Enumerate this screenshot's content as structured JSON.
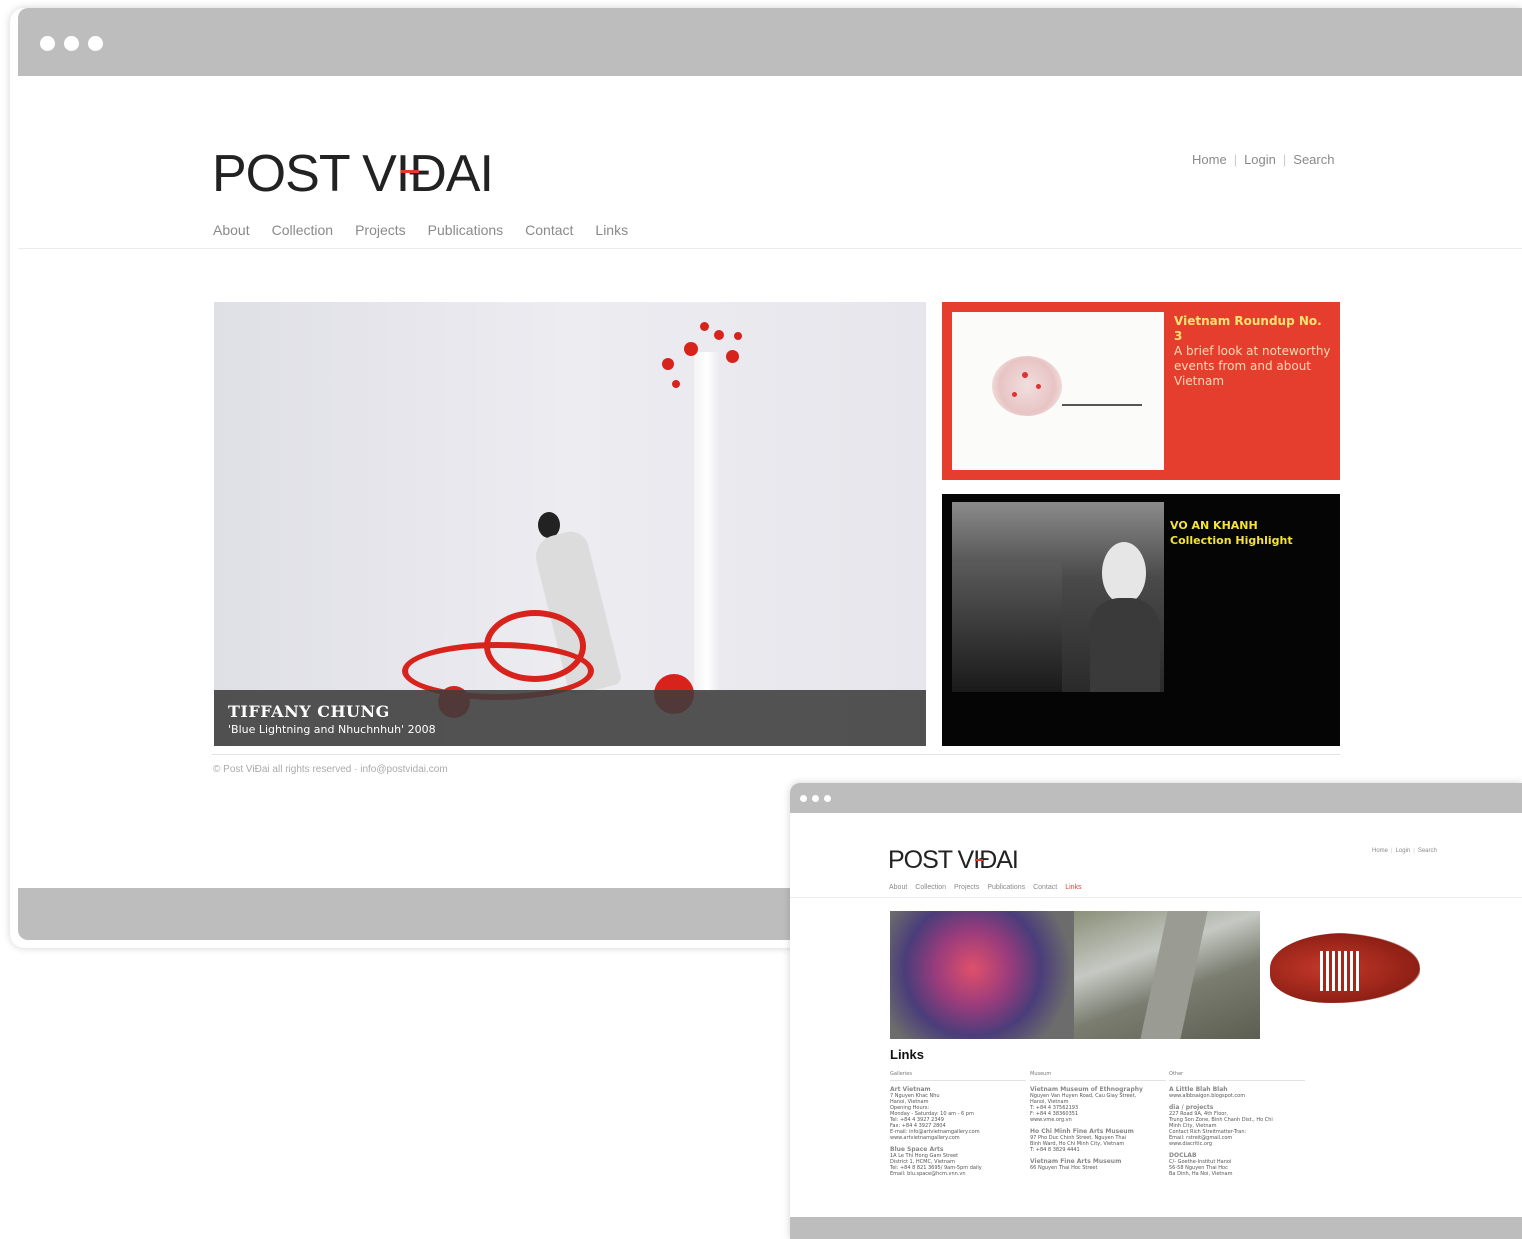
{
  "site": {
    "logo_prefix": "POST VI",
    "logo_d": "Đ",
    "logo_suffix": "AI",
    "topnav": [
      "Home",
      "Login",
      "Search"
    ],
    "nav": [
      "About",
      "Collection",
      "Projects",
      "Publications",
      "Contact",
      "Links"
    ],
    "colors": {
      "accent": "#e53e2e",
      "caption_yellow": "#f4e23a"
    }
  },
  "main_window": {
    "hero": {
      "artist": "TIFFANY CHUNG",
      "work": "'Blue Lightning and Nhuchnhuh' 2008"
    },
    "card_roundup": {
      "title": "Vietnam Roundup No. 3",
      "body": "A brief look at noteworthy events from and about Vietnam"
    },
    "card_highlight": {
      "title": "VO AN KHANH",
      "subtitle": "Collection Highlight"
    },
    "footer": "© Post ViĐai all rights reserved · info@postvidai.com"
  },
  "links_window": {
    "active_nav": "Links",
    "heading": "Links",
    "columns": [
      {
        "header": "Galleries",
        "entries": [
          {
            "name": "Art Vietnam",
            "lines": [
              "7 Nguyen Khac Nhu",
              "Hanoi, Vietnam",
              "Opening Hours:",
              "Monday - Saturday: 10 am - 6 pm",
              "Tel: +84 4 3927 2349",
              "Fax: +84 4 3927 2804",
              "E-mail: info@artvietnamgallery.com",
              "www.artvietnamgallery.com"
            ]
          },
          {
            "name": "Blue Space Arts",
            "lines": [
              "1A Le Thi Hong Gam Street",
              "District 1, HCMC, Vietnam",
              "Tel: +84 8 821 3695/ 9am-5pm daily",
              "Email: blu.space@hcm.vnn.vn"
            ]
          }
        ]
      },
      {
        "header": "Museum",
        "entries": [
          {
            "name": "Vietnam Museum of Ethnography",
            "lines": [
              "Nguyen Van Huyen Road, Cau Giay Street,",
              "Hanoi, Vietnam",
              "T: +84 4 37562193",
              "F: +84 4 38360351",
              "www.vme.org.vn"
            ]
          },
          {
            "name": "Ho Chi Minh Fine Arts Museum",
            "lines": [
              "97 Pho Duc Chinh Street, Nguyen Thai",
              "Binh Ward, Ho Chi Minh City, Vietnam",
              "T: +84 8 3829 4441"
            ]
          },
          {
            "name": "Vietnam Fine Arts Museum",
            "lines": [
              "66 Nguyen Thai Hoc Street"
            ]
          }
        ]
      },
      {
        "header": "Other",
        "entries": [
          {
            "name": "A Little Blah Blah",
            "lines": [
              "www.albbsaigon.blogspot.com"
            ]
          },
          {
            "name": "dia / projects",
            "lines": [
              "227 Road 9A, 4th Floor,",
              "Trung Son Zone, Binh Chanh Dist., Ho Chi",
              "Minh City, Vietnam",
              "Contact Rich Streitmatter-Tran:",
              "Email: rstreit@gmail.com",
              "www.diacritic.org"
            ]
          },
          {
            "name": "DOCLAB",
            "lines": [
              "C/- Goethe-Institut Hanoi",
              "56-58 Nguyen Thai Hoc",
              "Ba Dinh, Ha Noi, Vietnam"
            ]
          }
        ]
      }
    ]
  }
}
